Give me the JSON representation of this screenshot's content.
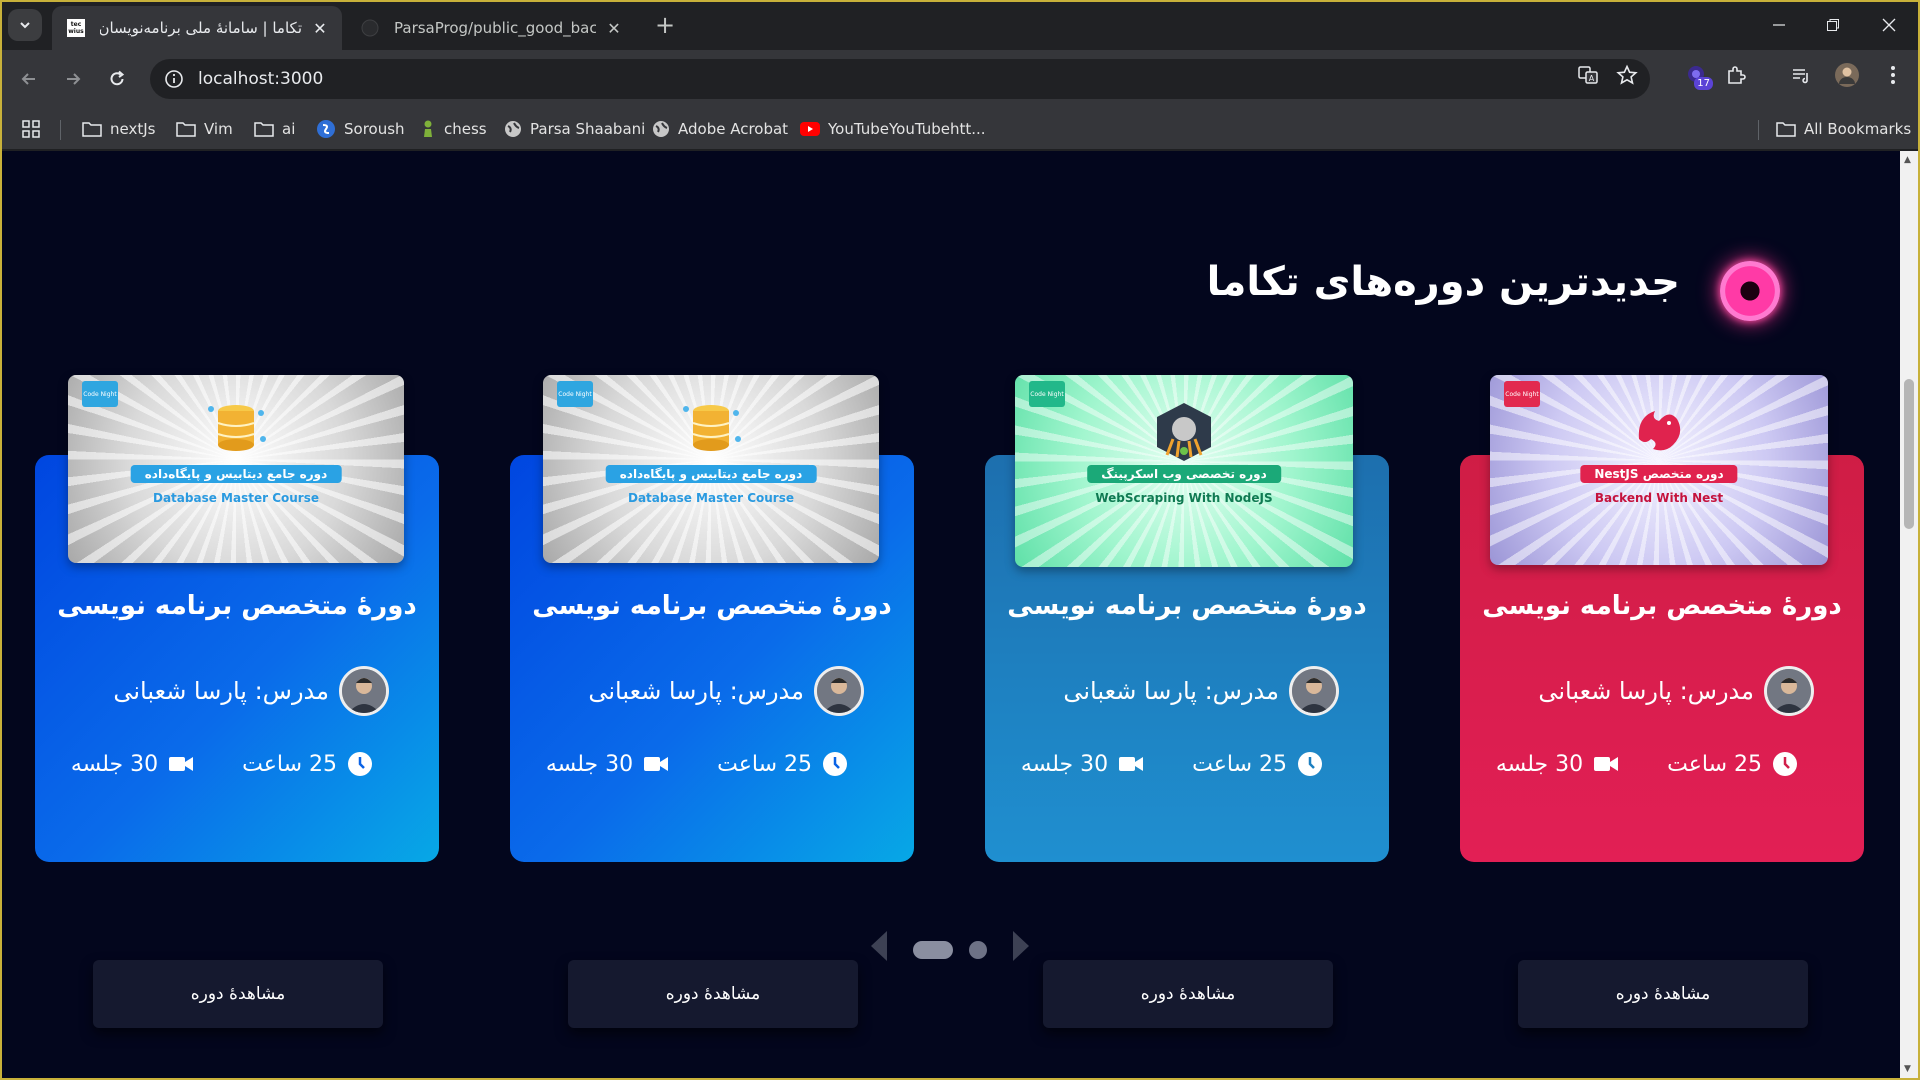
{
  "browser": {
    "tabs": [
      {
        "title": "تکاما | سامانهٔ ملی برنامه‌نویسان",
        "favicon": "tec-wius",
        "active": true
      },
      {
        "title": "ParsaProg/public_good_backgr",
        "favicon": "github-icon",
        "active": false
      }
    ],
    "tab_favicon_text": "tec wius",
    "url": "localhost:3000",
    "extension_badge": "17",
    "bookmarks": [
      {
        "label": "nextJs",
        "icon": "folder-icon"
      },
      {
        "label": "Vim",
        "icon": "folder-icon"
      },
      {
        "label": "ai",
        "icon": "folder-icon"
      },
      {
        "label": "Soroush",
        "icon": "soroush-icon"
      },
      {
        "label": "chess",
        "icon": "chess-pawn-icon"
      },
      {
        "label": "Parsa Shaabani",
        "icon": "globe-icon"
      },
      {
        "label": "Adobe Acrobat",
        "icon": "globe-icon"
      },
      {
        "label": "YouTubeYouTubehtt...",
        "icon": "youtube-icon"
      }
    ],
    "all_bookmarks": "All Bookmarks"
  },
  "page": {
    "section_title": "جدیدترین دوره‌های تکاما",
    "cards": [
      {
        "thumb_ribbon": "دوره متخصص NestJS",
        "thumb_sub": "Backend With Nest",
        "thumb_logo": "Code Night",
        "title": "دورهٔ متخصص برنامه نویسی",
        "teacher": "مدرس: پارسا شعبانی",
        "hours": "25 ساعت",
        "sessions": "30 جلسه",
        "button": "مشاهدهٔ دوره",
        "accent": "#dc1f4a"
      },
      {
        "thumb_ribbon": "دوره تخصصی وب اسکرپینگ",
        "thumb_sub": "WebScraping With NodeJS",
        "thumb_logo": "Code Night",
        "title": "دورهٔ متخصص برنامه نویسی",
        "teacher": "مدرس: پارسا شعبانی",
        "hours": "25 ساعت",
        "sessions": "30 جلسه",
        "button": "مشاهدهٔ دوره",
        "accent": "#1c7fc0"
      },
      {
        "thumb_ribbon": "دوره جامع دیتابیس و پایگاه‌داده",
        "thumb_sub": "Database Master Course",
        "thumb_logo": "Code Night",
        "title": "دورهٔ متخصص برنامه نویسی",
        "teacher": "مدرس: پارسا شعبانی",
        "hours": "25 ساعت",
        "sessions": "30 جلسه",
        "button": "مشاهدهٔ دوره",
        "accent": "#0a63e6"
      },
      {
        "thumb_ribbon": "دوره جامع دیتابیس و پایگاه‌داده",
        "thumb_sub": "Database Master Course",
        "thumb_logo": "Code Night",
        "title": "دورهٔ متخصص برنامه نویسی",
        "teacher": "مدرس: پارسا شعبانی",
        "hours": "25 ساعت",
        "sessions": "30 جلسه",
        "button": "مشاهدهٔ دوره",
        "accent": "#0a63e6"
      }
    ],
    "pager": {
      "pages": 2,
      "current": 1
    }
  }
}
